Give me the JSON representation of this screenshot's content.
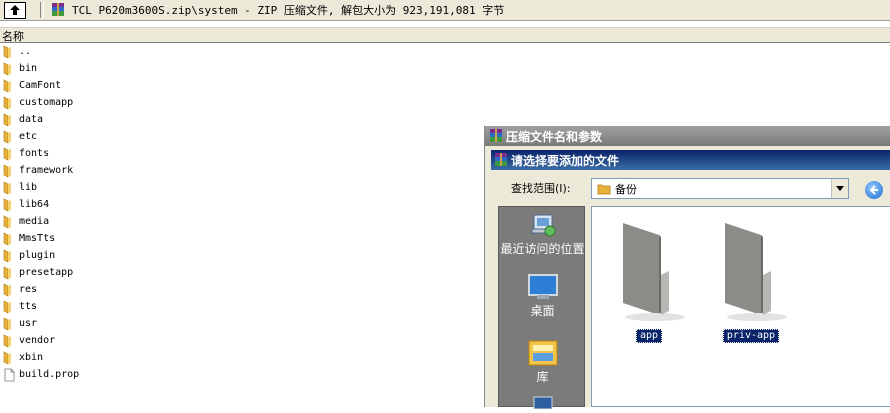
{
  "toolbar": {
    "path_text": "TCL P620m3600S.zip\\system - ZIP 压缩文件, 解包大小为 923,191,081 字节"
  },
  "list_header": {
    "name_column": "名称"
  },
  "files": [
    {
      "name": "..",
      "type": "folder"
    },
    {
      "name": "bin",
      "type": "folder"
    },
    {
      "name": "CamFont",
      "type": "folder"
    },
    {
      "name": "customapp",
      "type": "folder"
    },
    {
      "name": "data",
      "type": "folder"
    },
    {
      "name": "etc",
      "type": "folder"
    },
    {
      "name": "fonts",
      "type": "folder"
    },
    {
      "name": "framework",
      "type": "folder"
    },
    {
      "name": "lib",
      "type": "folder"
    },
    {
      "name": "lib64",
      "type": "folder"
    },
    {
      "name": "media",
      "type": "folder"
    },
    {
      "name": "MmsTts",
      "type": "folder"
    },
    {
      "name": "plugin",
      "type": "folder"
    },
    {
      "name": "presetapp",
      "type": "folder"
    },
    {
      "name": "res",
      "type": "folder"
    },
    {
      "name": "tts",
      "type": "folder"
    },
    {
      "name": "usr",
      "type": "folder"
    },
    {
      "name": "vendor",
      "type": "folder"
    },
    {
      "name": "xbin",
      "type": "folder"
    },
    {
      "name": "build.prop",
      "type": "file"
    }
  ],
  "dialog": {
    "title": "压缩文件名和参数",
    "subtitle": "请选择要添加的文件",
    "look_in_label": "查找范围(I):",
    "look_in_value": "备份",
    "places": {
      "recent": "最近访问的位置",
      "desktop": "桌面",
      "library": "库"
    },
    "folders": [
      "app",
      "priv-app"
    ]
  },
  "colors": {
    "titlebar_active": "#0a246a",
    "titlebar_inactive": "#7a7a7a",
    "places_bg": "#7b7b7b",
    "folder_yellow": "#e8b23a"
  }
}
